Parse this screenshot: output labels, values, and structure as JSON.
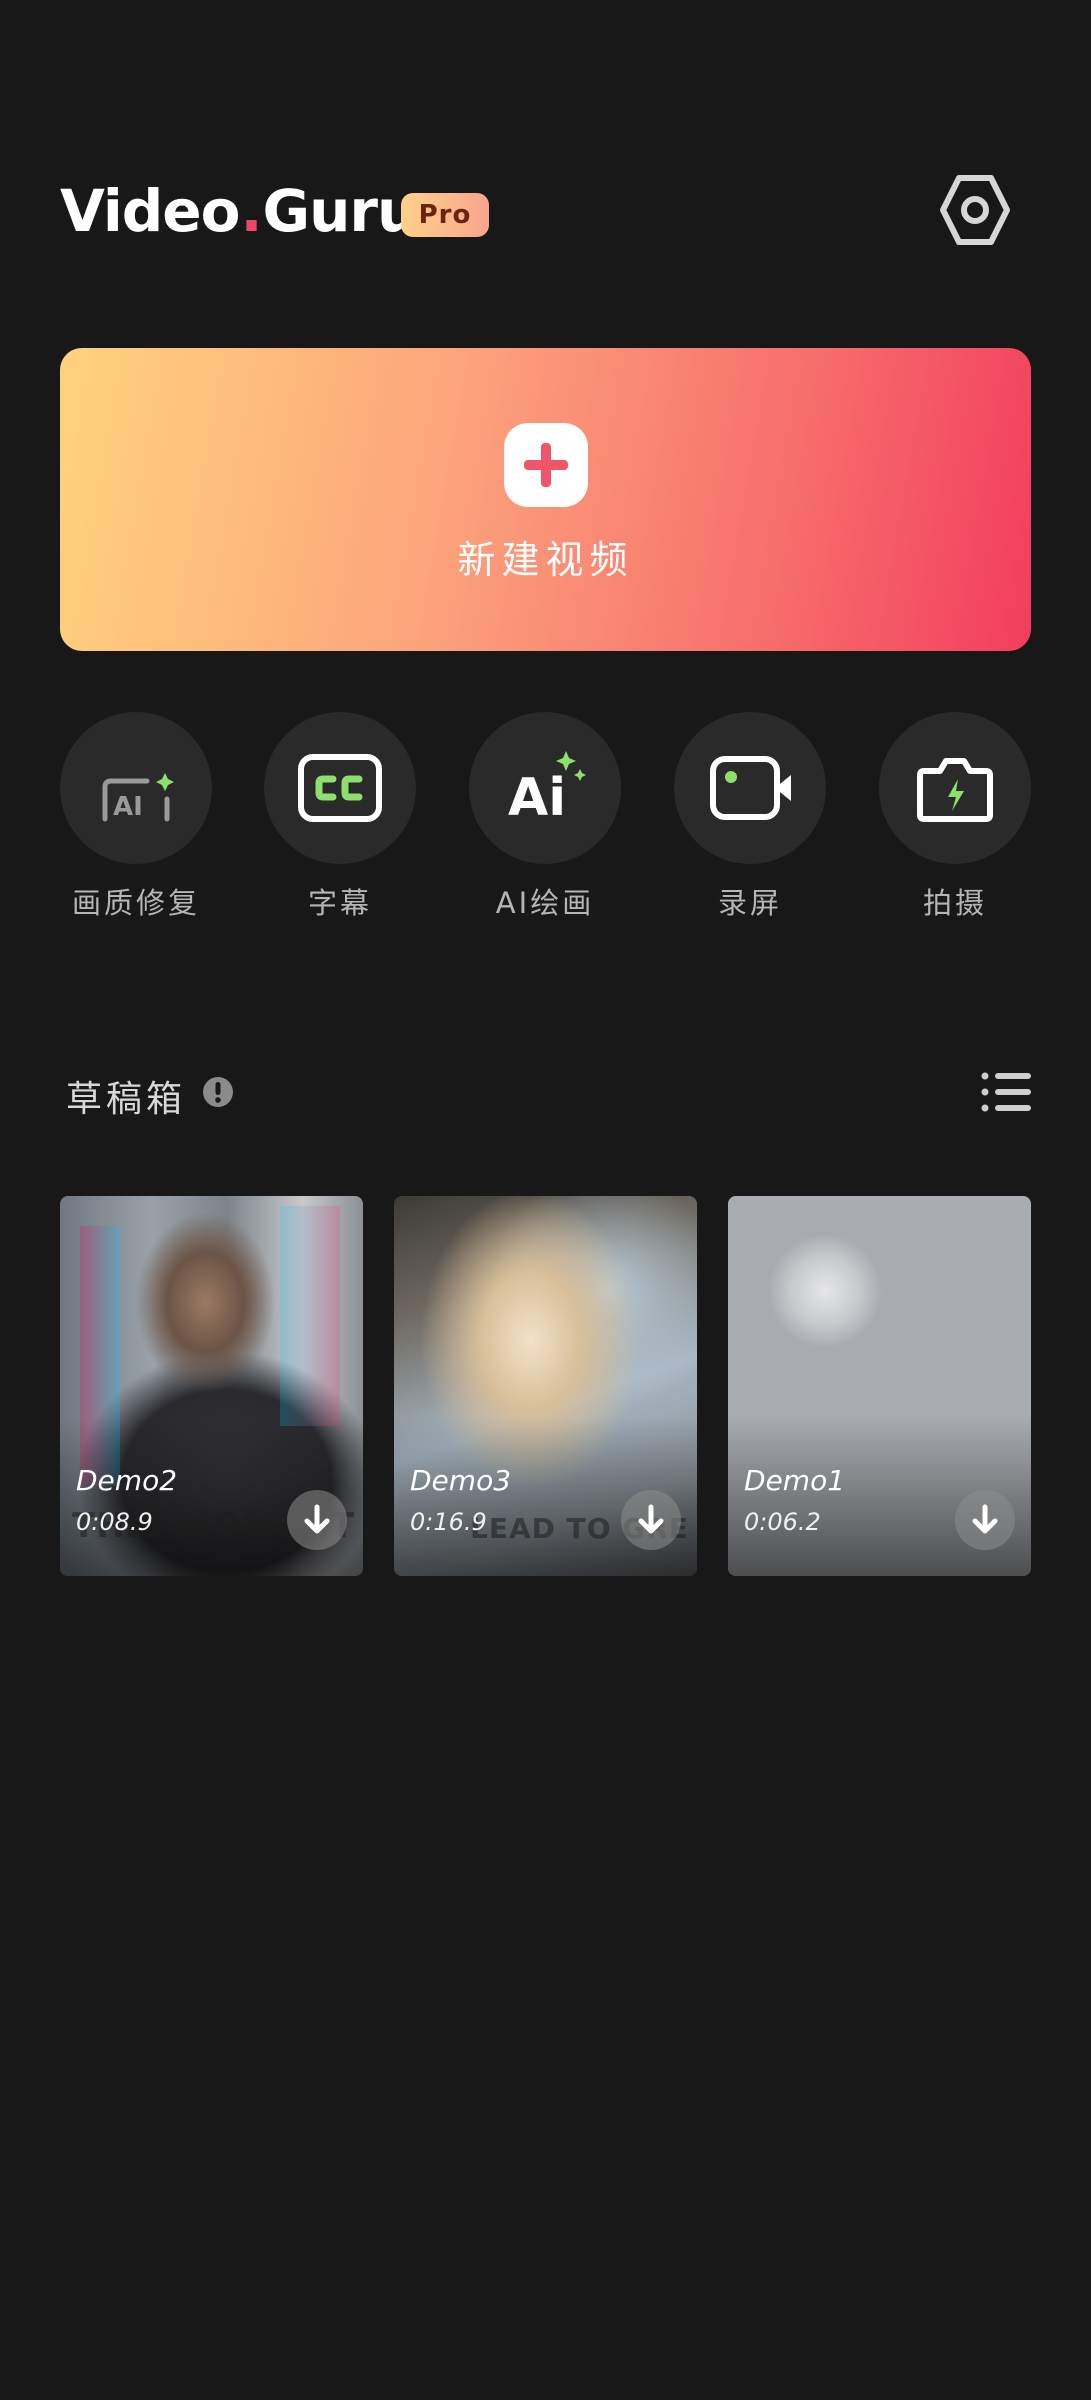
{
  "app": {
    "logo_text_a": "Video",
    "logo_dot": ".",
    "logo_text_b": "Guru",
    "badge": "Pro",
    "settings_icon": "hexagon-settings-icon"
  },
  "create": {
    "label": "新建视频",
    "icon": "plus-icon"
  },
  "tools": [
    {
      "label": "画质修复",
      "icon": "ai-enhance-icon"
    },
    {
      "label": "字幕",
      "icon": "cc-subtitle-icon"
    },
    {
      "label": "AI绘画",
      "icon": "ai-painting-icon"
    },
    {
      "label": "录屏",
      "icon": "screen-record-icon"
    },
    {
      "label": "拍摄",
      "icon": "camera-icon"
    }
  ],
  "drafts": {
    "title": "草稿箱",
    "info_icon": "info-icon",
    "list_icon": "list-view-icon",
    "items": [
      {
        "name": "Demo2",
        "duration": "0:08.9",
        "overlay": "THIS MOMENT",
        "icon": "download-icon"
      },
      {
        "name": "Demo3",
        "duration": "0:16.9",
        "overlay": "LEAD TO GRE",
        "icon": "download-icon"
      },
      {
        "name": "Demo1",
        "duration": "0:06.2",
        "overlay": "",
        "icon": "download-icon"
      }
    ]
  },
  "colors": {
    "background": "#181818",
    "accent_pink": "#f0456a",
    "card_gradient_start": "#ffd37d",
    "card_gradient_end": "#f23d5e",
    "icon_green": "#8ee06e"
  }
}
